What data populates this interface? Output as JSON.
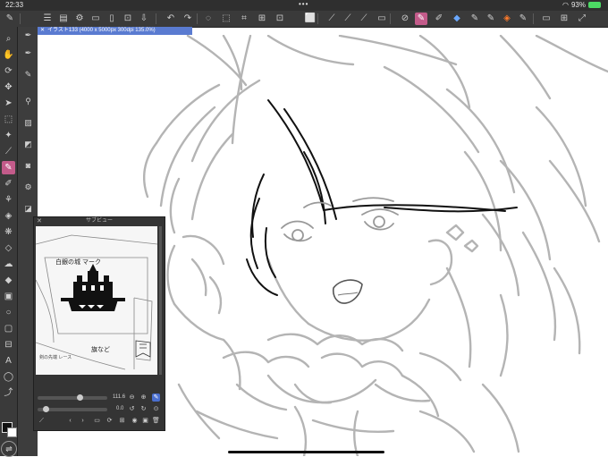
{
  "status_bar": {
    "time": "22:33",
    "dots": "•••",
    "battery": "93%"
  },
  "canvas_tab": {
    "close": "✕",
    "title": "イラスト133 (4000 x 5000px 300dpi 135.0%)"
  },
  "sub_view": {
    "title": "サブビュー",
    "close": "✕",
    "zoom_value": "111.6",
    "rotation_value": "0.0",
    "sketch_texts": [
      "白銀の城 マーク",
      "旗など",
      "剣の先端 レース"
    ]
  },
  "colors": {
    "accent": "#c35b8a",
    "tab_blue": "#5a7bd1",
    "ui_dark": "#3a3a3a",
    "line_gray": "#b4b4b4",
    "ink_black": "#111111"
  },
  "icons": {
    "command_bar": [
      "pen-icon",
      "menu-icon",
      "layers-icon",
      "settings-icon",
      "new-file-icon",
      "open-icon",
      "save-icon",
      "undo-icon",
      "redo-icon",
      "selection-icon",
      "transform-icon",
      "crop-icon",
      "fit-screen-icon",
      "rotate-icon",
      "ruler-icon",
      "clear-selection-icon",
      "fill-icon",
      "eyedropper-icon",
      "brush-icon",
      "airbrush-icon",
      "eraser-icon",
      "color-icon",
      "settings-gear-icon",
      "display-icon",
      "expand-icon"
    ],
    "tools": [
      "zoom-icon",
      "hand-icon",
      "rotate-view-icon",
      "move-icon",
      "select-icon",
      "lasso-icon",
      "magic-wand-icon",
      "eyedropper-tool-icon",
      "pen-tool-icon",
      "pencil-tool-icon",
      "brush-tool-icon",
      "airbrush-tool-icon",
      "decoration-icon",
      "eraser-tool-icon",
      "blend-icon",
      "fill-tool-icon",
      "gradient-icon",
      "figure-icon",
      "frame-icon",
      "ruler-tool-icon",
      "text-icon",
      "balloon-icon",
      "correction-icon"
    ]
  }
}
